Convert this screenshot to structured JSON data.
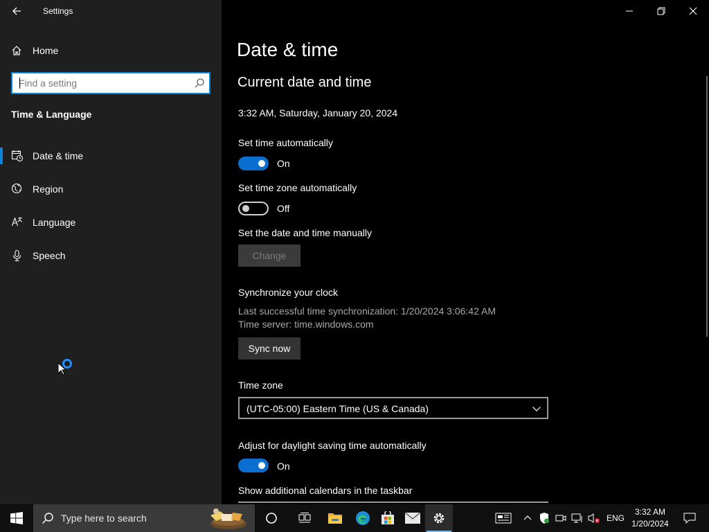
{
  "window": {
    "title": "Settings",
    "controls": {
      "minimize": "minimize",
      "restore": "restore",
      "close": "close"
    }
  },
  "sidebar": {
    "home_label": "Home",
    "search_placeholder": "Find a setting",
    "section_title": "Time & Language",
    "items": [
      {
        "label": "Date & time",
        "icon": "date-time-icon",
        "selected": true
      },
      {
        "label": "Region",
        "icon": "globe-icon",
        "selected": false
      },
      {
        "label": "Language",
        "icon": "language-icon",
        "selected": false
      },
      {
        "label": "Speech",
        "icon": "microphone-icon",
        "selected": false
      }
    ]
  },
  "content": {
    "page_title": "Date & time",
    "sub_title": "Current date and time",
    "current_datetime": "3:32 AM, Saturday, January 20, 2024",
    "set_time_auto": {
      "label": "Set time automatically",
      "state": "On"
    },
    "set_tz_auto": {
      "label": "Set time zone automatically",
      "state": "Off"
    },
    "manual": {
      "label": "Set the date and time manually",
      "button": "Change"
    },
    "sync": {
      "label": "Synchronize your clock",
      "last_sync": "Last successful time synchronization: 1/20/2024 3:06:42 AM",
      "server": "Time server: time.windows.com",
      "button": "Sync now"
    },
    "timezone": {
      "label": "Time zone",
      "value": "(UTC-05:00) Eastern Time (US & Canada)"
    },
    "dst": {
      "label": "Adjust for daylight saving time automatically",
      "state": "On"
    },
    "calendars": {
      "label": "Show additional calendars in the taskbar"
    }
  },
  "taskbar": {
    "search_placeholder": "Type here to search",
    "apps": [
      "cortana-icon",
      "task-view-icon",
      "file-explorer-icon",
      "edge-icon",
      "store-icon",
      "mail-icon",
      "settings-icon"
    ],
    "tray": {
      "language": "ENG",
      "time": "3:32 AM",
      "date": "1/20/2024"
    }
  },
  "colors": {
    "accent": "#0a6fd1",
    "sidebar_bg": "#1f1f1f",
    "content_bg": "#000000",
    "taskbar_bg": "#101010"
  }
}
